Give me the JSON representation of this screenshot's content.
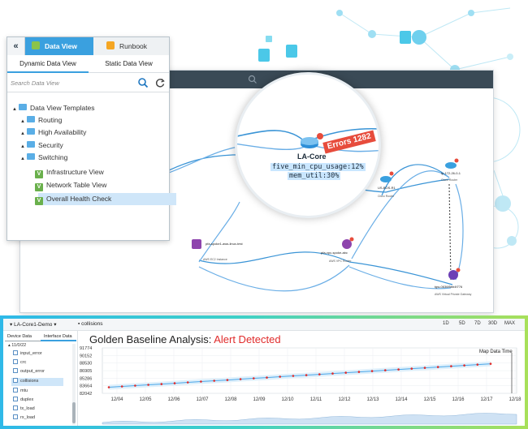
{
  "left_panel": {
    "collapse_glyph": "«",
    "tabs": [
      {
        "label": "Data View",
        "icon": "data-view-icon",
        "active": true
      },
      {
        "label": "Runbook",
        "icon": "runbook-icon",
        "active": false
      }
    ],
    "subtabs": [
      {
        "label": "Dynamic Data View",
        "active": true
      },
      {
        "label": "Static Data View",
        "active": false
      }
    ],
    "search": {
      "placeholder": "Search Data View",
      "value": ""
    },
    "tree": [
      {
        "label": "Data View Templates",
        "level": 0,
        "type": "folder",
        "expanded": true
      },
      {
        "label": "Routing",
        "level": 1,
        "type": "folder",
        "expanded": false
      },
      {
        "label": "High Availability",
        "level": 1,
        "type": "folder",
        "expanded": false
      },
      {
        "label": "Security",
        "level": 1,
        "type": "folder",
        "expanded": false
      },
      {
        "label": "Switching",
        "level": 1,
        "type": "folder",
        "expanded": true
      },
      {
        "label": "Infrastructure View",
        "level": 2,
        "type": "view"
      },
      {
        "label": "Network Table View",
        "level": 2,
        "type": "view"
      },
      {
        "label": "Overall Health Check",
        "level": 2,
        "type": "view",
        "selected": true
      }
    ]
  },
  "magnifier": {
    "node_name": "LA-Core",
    "cpu_label": "five_min_cpu_usage:12%",
    "mem_label": "mem_util:30%",
    "errors_badge": "Errors 1282"
  },
  "map": {
    "nodes": [
      {
        "label": "US-BOS-R1",
        "sub": "Cisco Router"
      },
      {
        "label": "lp-172-26-0-1",
        "sub": "Cisco Router"
      },
      {
        "label": "pfa-spoke1-aws-linux-test",
        "sub": "AWS EC2 Instance"
      },
      {
        "label": "pfa-vpc-spoke-abc",
        "sub": "AWS VPC Router"
      },
      {
        "label": "tgw-0636f5bb4f776",
        "sub": "AWS Virtual Private Gateway"
      }
    ]
  },
  "bottom_panel": {
    "device_tab": "LA-Core1-Demo",
    "chart_tab": "collisions",
    "time_ranges": [
      "1D",
      "5D",
      "7D",
      "30D",
      "MAX"
    ],
    "side_tabs": [
      "Device Data",
      "Interface Data"
    ],
    "side_items": [
      {
        "label": "11/0/22",
        "selected": false
      },
      {
        "label": "input_error",
        "selected": false
      },
      {
        "label": "crc",
        "selected": false
      },
      {
        "label": "output_error",
        "selected": false
      },
      {
        "label": "collisions",
        "selected": true
      },
      {
        "label": "mtu",
        "selected": false
      },
      {
        "label": "duplex",
        "selected": false
      },
      {
        "label": "tx_load",
        "selected": false
      },
      {
        "label": "rx_load",
        "selected": false
      }
    ],
    "title_main": "Golden Baseline Analysis:",
    "title_alert": "Alert Detected",
    "map_data_time_label": "Map Data Time",
    "alert_color": "#e02b2b"
  },
  "chart_data": {
    "type": "line",
    "title": "Golden Baseline Analysis: Alert Detected",
    "categories": [
      "12/04",
      "12/05",
      "12/06",
      "12/07",
      "12/08",
      "12/09",
      "12/10",
      "12/11",
      "12/12",
      "12/13",
      "12/14",
      "12/15",
      "12/16",
      "12/17",
      "12/18"
    ],
    "y_ticks": [
      82042,
      83664,
      85286,
      86905,
      88530,
      90152,
      91774
    ],
    "ylim": [
      82042,
      91774
    ],
    "series": [
      {
        "values": [
          83350,
          83520,
          83690,
          83860,
          84030,
          84200,
          84380,
          84560,
          84730,
          84900,
          85080,
          85250,
          85420,
          85600,
          85770,
          85940,
          86110,
          86290,
          86460,
          86630,
          86810,
          86980,
          87150,
          87330,
          87500,
          87670,
          87850,
          88020,
          88190,
          88360
        ]
      }
    ],
    "grid": true
  }
}
